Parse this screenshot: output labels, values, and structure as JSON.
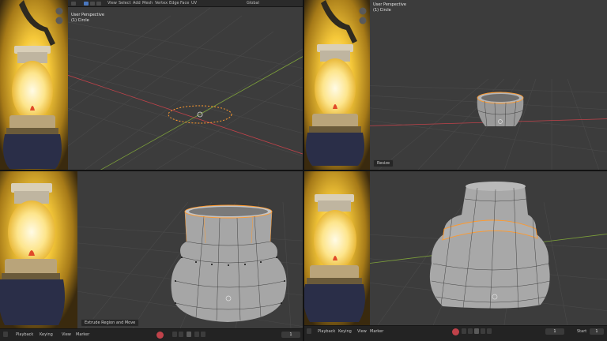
{
  "viewport_overlays": {
    "q1": {
      "line1": "User Perspective",
      "line2": "(1) Circle"
    },
    "q2": {
      "line1": "User Perspective",
      "line2": "(1) Circle"
    }
  },
  "operator_panels": {
    "q2": "Resize",
    "q3": "Extrude Region and Move"
  },
  "header_top_left": {
    "items": [
      "View",
      "Select",
      "Add",
      "Mesh",
      "Vertex",
      "Edge",
      "Face",
      "UV"
    ],
    "transform": "Global"
  },
  "timeline_left": {
    "menu": [
      "Playback",
      "Keying",
      "View",
      "Marker"
    ],
    "frame": "1"
  },
  "timeline_right": {
    "menu": [
      "Playback",
      "Keying",
      "View",
      "Marker"
    ],
    "frame": "1",
    "start_label": "Start",
    "start_value": "1"
  },
  "icons": {
    "play": "play-icon",
    "jump_start": "jump-start-icon",
    "jump_end": "jump-end-icon",
    "step_back": "step-back-icon",
    "step_forward": "step-forward-icon",
    "record": "record-icon",
    "zoom": "zoom-icon",
    "pan": "hand-icon",
    "editor_type": "clock-icon"
  },
  "colors": {
    "viewport_bg": "#3c3c3c",
    "selection_orange": "#ff9a2e",
    "x_axis": "#c0424a",
    "y_axis": "#7da03a",
    "lamp_glow": "#f6c93a"
  }
}
